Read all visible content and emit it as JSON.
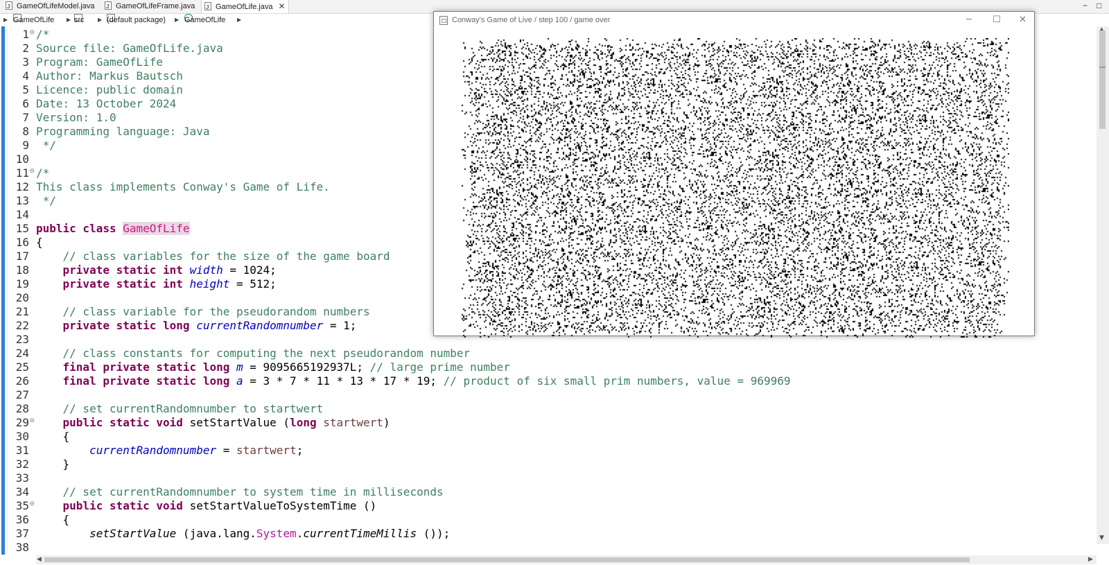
{
  "editor_tabs": [
    {
      "label": "GameOfLifeModel.java",
      "active": false
    },
    {
      "label": "GameOfLifeFrame.java",
      "active": false
    },
    {
      "label": "GameOfLife.java",
      "active": true,
      "close": "✕"
    }
  ],
  "window_controls": {
    "minimize": "−",
    "maximize": "□"
  },
  "breadcrumb": {
    "project": "GameOfLife",
    "src": "src",
    "package": "(default package)",
    "class": "GameOfLife"
  },
  "code": {
    "line_numbers": [
      "1",
      "2",
      "3",
      "4",
      "5",
      "6",
      "7",
      "8",
      "9",
      "10",
      "11",
      "12",
      "13",
      "14",
      "15",
      "16",
      "17",
      "18",
      "19",
      "20",
      "21",
      "22",
      "23",
      "24",
      "25",
      "26",
      "27",
      "28",
      "29",
      "30",
      "31",
      "32",
      "33",
      "34",
      "35",
      "36",
      "37",
      "38"
    ],
    "lines": [
      [
        {
          "t": "/*",
          "c": "cm"
        }
      ],
      [
        {
          "t": "Source file: GameOfLife.java",
          "c": "cm"
        }
      ],
      [
        {
          "t": "Program: GameOfLife",
          "c": "cm"
        }
      ],
      [
        {
          "t": "Author: Markus Bautsch",
          "c": "cm"
        }
      ],
      [
        {
          "t": "Licence: public domain",
          "c": "cm"
        }
      ],
      [
        {
          "t": "Date: 13 October 2024",
          "c": "cm"
        }
      ],
      [
        {
          "t": "Version: 1.0",
          "c": "cm"
        }
      ],
      [
        {
          "t": "Programming language: Java",
          "c": "cm"
        }
      ],
      [
        {
          "t": " */",
          "c": "cm"
        }
      ],
      [],
      [
        {
          "t": "/*",
          "c": "cm"
        }
      ],
      [
        {
          "t": "This class implements Conway's Game of Life.",
          "c": "cm"
        }
      ],
      [
        {
          "t": " */",
          "c": "cm"
        }
      ],
      [],
      [
        {
          "t": "public class ",
          "c": "kw"
        },
        {
          "t": "GameOfLife",
          "c": "hl"
        }
      ],
      [
        {
          "t": "{",
          "c": ""
        }
      ],
      [
        {
          "t": "    // class variables for the size of the game board",
          "c": "cm"
        }
      ],
      [
        {
          "t": "    private static int ",
          "c": "kw"
        },
        {
          "t": "width",
          "c": "fld"
        },
        {
          "t": " = 1024;",
          "c": ""
        }
      ],
      [
        {
          "t": "    private static int ",
          "c": "kw"
        },
        {
          "t": "height",
          "c": "fld"
        },
        {
          "t": " = 512;",
          "c": ""
        }
      ],
      [],
      [
        {
          "t": "    // class variable for the pseudorandom numbers",
          "c": "cm"
        }
      ],
      [
        {
          "t": "    private static long ",
          "c": "kw"
        },
        {
          "t": "currentRandomnumber",
          "c": "fld"
        },
        {
          "t": " = 1;",
          "c": ""
        }
      ],
      [],
      [
        {
          "t": "    // class constants for computing the next pseudorandom number",
          "c": "cm"
        }
      ],
      [
        {
          "t": "    final private static long ",
          "c": "kw"
        },
        {
          "t": "m",
          "c": "fld"
        },
        {
          "t": " = 9095665192937L; ",
          "c": ""
        },
        {
          "t": "// large prime number",
          "c": "cm"
        }
      ],
      [
        {
          "t": "    final private static long ",
          "c": "kw"
        },
        {
          "t": "a",
          "c": "fld"
        },
        {
          "t": " = 3 * 7 * 11 * 13 * 17 * 19; ",
          "c": ""
        },
        {
          "t": "// product of six small prim numbers, value = 969969",
          "c": "cm"
        }
      ],
      [],
      [
        {
          "t": "    // set currentRandomnumber to startwert",
          "c": "cm"
        }
      ],
      [
        {
          "t": "    public static void ",
          "c": "kw"
        },
        {
          "t": "setStartValue (",
          "c": ""
        },
        {
          "t": "long ",
          "c": "kw"
        },
        {
          "t": "startwert",
          "c": "par"
        },
        {
          "t": ")",
          "c": ""
        }
      ],
      [
        {
          "t": "    {",
          "c": ""
        }
      ],
      [
        {
          "t": "        ",
          "c": ""
        },
        {
          "t": "currentRandomnumber",
          "c": "fld"
        },
        {
          "t": " = ",
          "c": ""
        },
        {
          "t": "startwert",
          "c": "par"
        },
        {
          "t": ";",
          "c": ""
        }
      ],
      [
        {
          "t": "    }",
          "c": ""
        }
      ],
      [],
      [
        {
          "t": "    // set currentRandomnumber to system time in milliseconds",
          "c": "cm"
        }
      ],
      [
        {
          "t": "    public static void ",
          "c": "kw"
        },
        {
          "t": "setStartValueToSystemTime ()",
          "c": ""
        }
      ],
      [
        {
          "t": "    {",
          "c": ""
        }
      ],
      [
        {
          "t": "        ",
          "c": ""
        },
        {
          "t": "setStartValue",
          "c": "mth"
        },
        {
          "t": " (java.lang.",
          "c": ""
        },
        {
          "t": "System",
          "c": "sys"
        },
        {
          "t": ".",
          "c": ""
        },
        {
          "t": "currentTimeMillis",
          "c": "mth"
        },
        {
          "t": " ());",
          "c": ""
        }
      ],
      [
        {
          "t": "    }",
          "c": ""
        }
      ]
    ]
  },
  "game_window": {
    "title": "Conway's Game of Live / step 100 / game over",
    "minimize": "─",
    "maximize": "☐",
    "close": "✕",
    "board_density": 0.16
  },
  "colors": {
    "comment": "#3f7f5f",
    "keyword": "#7f0055",
    "field": "#0000c0",
    "highlight": "#e8d8e8",
    "sidebar": "#2d7fd6"
  }
}
